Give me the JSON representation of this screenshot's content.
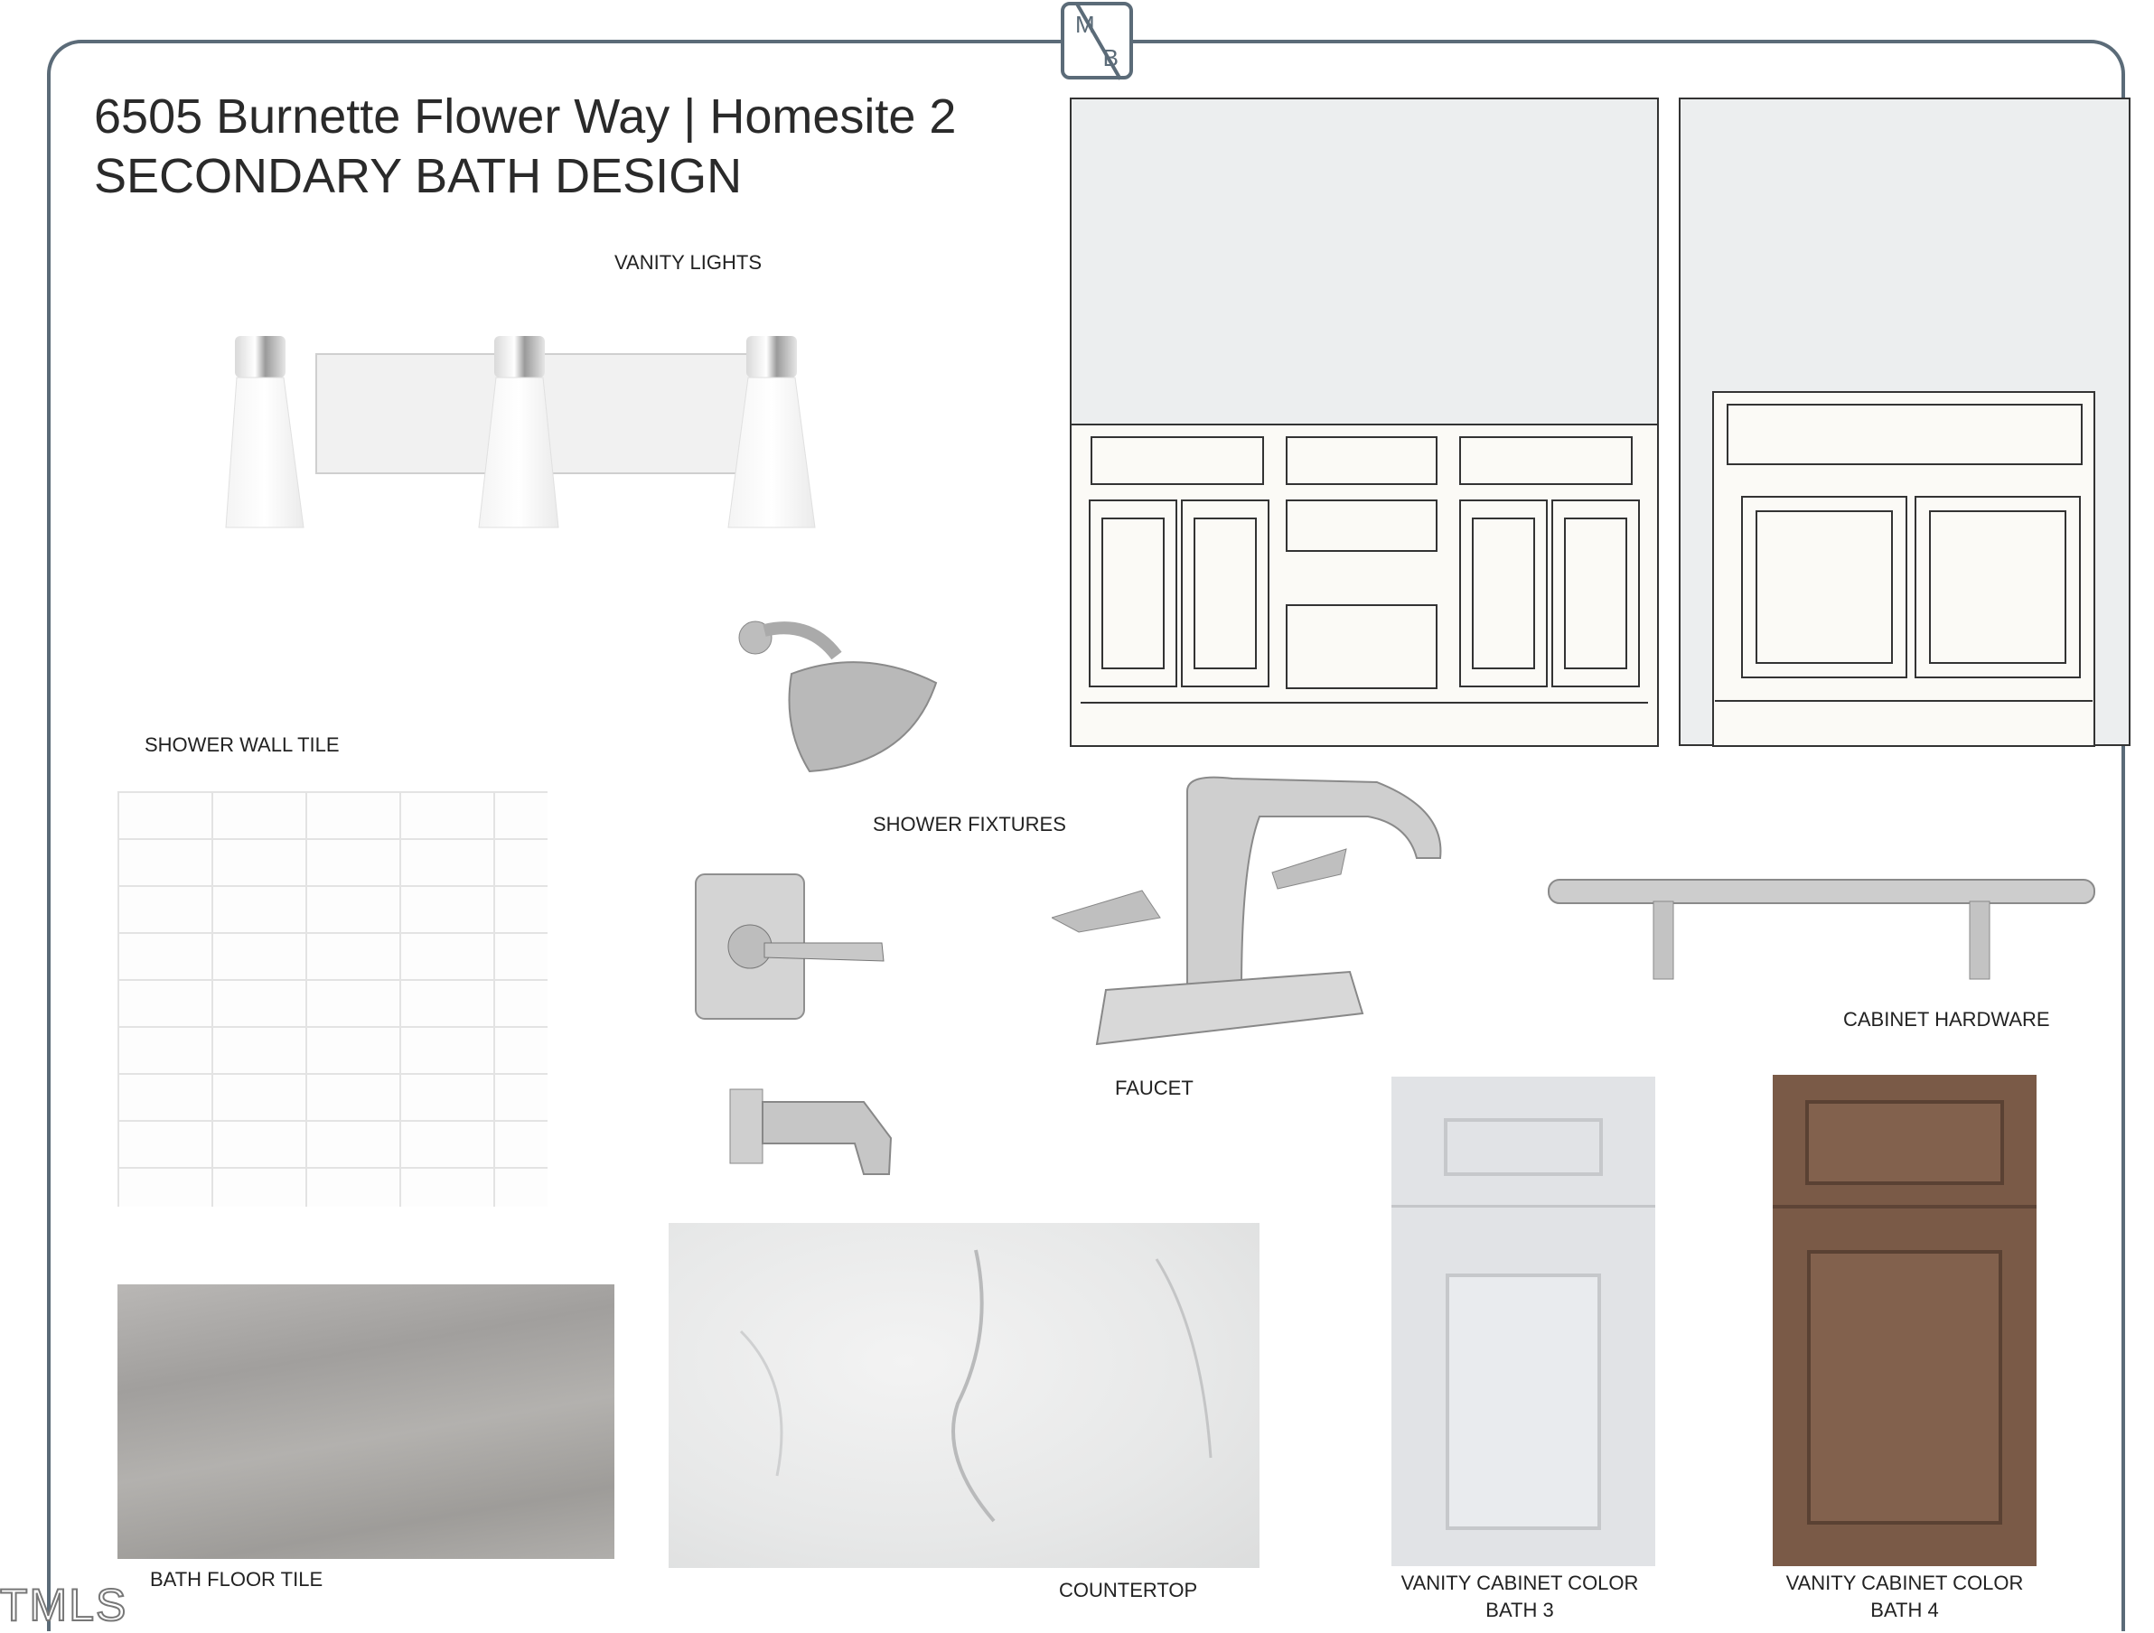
{
  "logo": {
    "m": "M",
    "b": "B"
  },
  "header": {
    "title": "6505 Burnette Flower Way | Homesite 2",
    "subtitle": "SECONDARY BATH DESIGN"
  },
  "labels": {
    "vanity_lights": "VANITY LIGHTS",
    "shower_wall_tile": "SHOWER WALL TILE",
    "shower_fixtures": "SHOWER FIXTURES",
    "faucet": "FAUCET",
    "cabinet_hardware": "CABINET HARDWARE",
    "bath_floor_tile": "BATH FLOOR TILE",
    "countertop": "COUNTERTOP",
    "vanity_bath3_line1": "VANITY CABINET COLOR",
    "vanity_bath3_line2": "BATH 3",
    "vanity_bath4_line1": "VANITY CABINET COLOR",
    "vanity_bath4_line2": "BATH 4"
  },
  "watermark": "TMLS",
  "colors": {
    "frame": "#5b6b78",
    "wall": "#eceeef",
    "cabinet": "#fbfaf6",
    "floor_tile": "#a9a7a5",
    "countertop": "#eceded",
    "bath3_cabinet": "#e1e3e6",
    "bath4_cabinet": "#7a5a47"
  }
}
